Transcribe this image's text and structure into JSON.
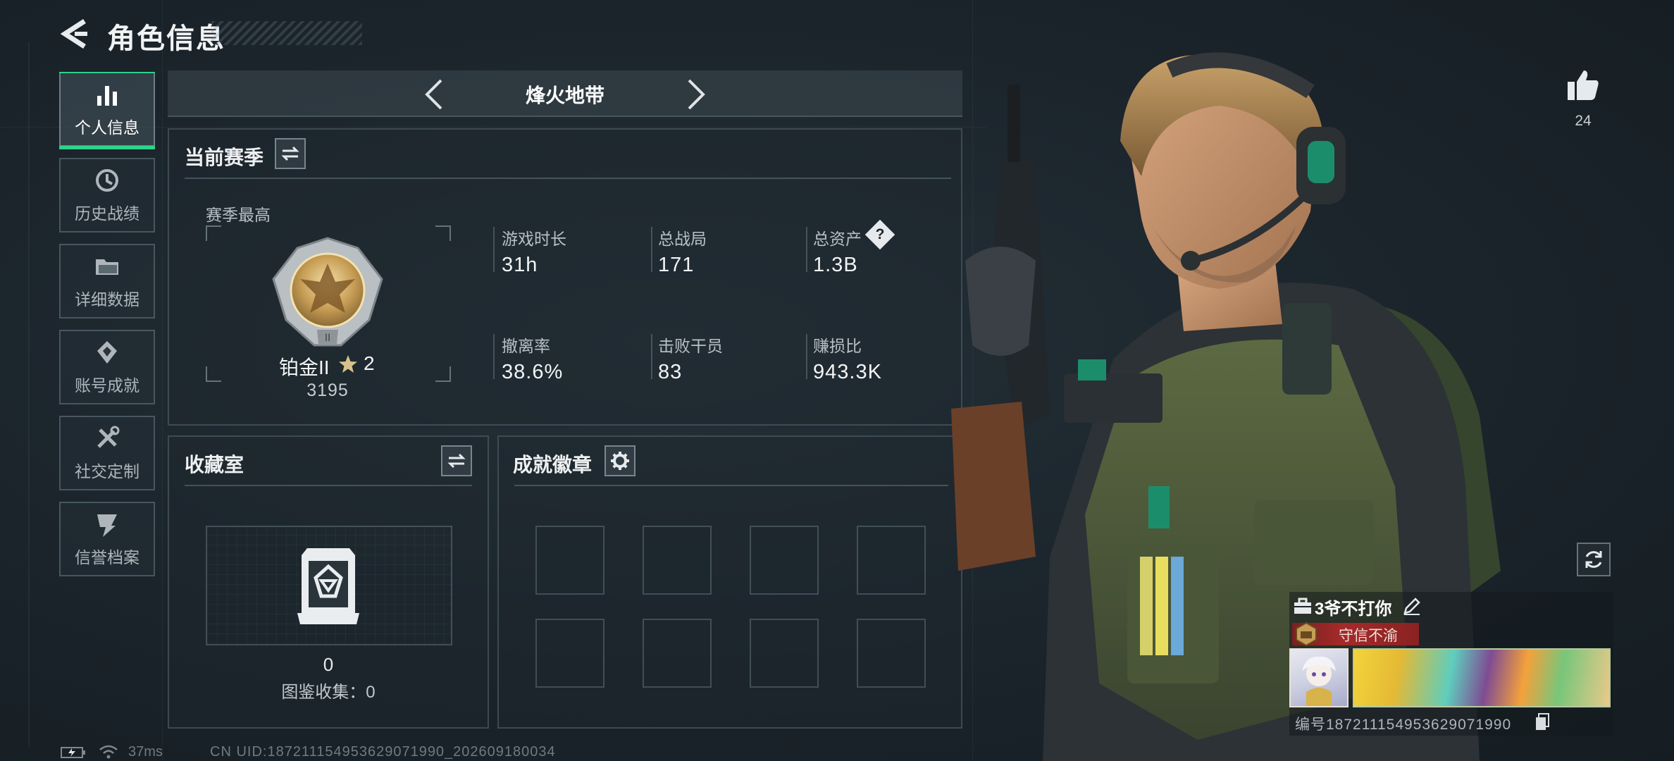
{
  "header": {
    "title": "角色信息"
  },
  "sidebar": {
    "items": [
      {
        "label": "个人信息",
        "icon": "bar-chart-icon",
        "active": true
      },
      {
        "label": "历史战绩",
        "icon": "history-clock-icon",
        "active": false
      },
      {
        "label": "详细数据",
        "icon": "folder-icon",
        "active": false
      },
      {
        "label": "账号成就",
        "icon": "achievement-icon",
        "active": false
      },
      {
        "label": "社交定制",
        "icon": "tools-icon",
        "active": false
      },
      {
        "label": "信誉档案",
        "icon": "credit-shield-icon",
        "active": false
      }
    ]
  },
  "mode": {
    "title": "烽火地带"
  },
  "season": {
    "heading": "当前赛季",
    "best_label": "赛季最高",
    "rank": "铂金II",
    "stars": "2",
    "score": "3195",
    "stats": [
      {
        "label": "游戏时长",
        "value": "31h"
      },
      {
        "label": "总战局",
        "value": "171"
      },
      {
        "label": "总资产",
        "value": "1.3B",
        "help": "?"
      },
      {
        "label": "撤离率",
        "value": "38.6%"
      },
      {
        "label": "击败干员",
        "value": "83"
      },
      {
        "label": "赚损比",
        "value": "943.3K"
      }
    ]
  },
  "collection": {
    "heading": "收藏室",
    "count": "0",
    "catalog_text": "图鉴收集：0"
  },
  "badges": {
    "heading": "成就徽章"
  },
  "player": {
    "likes": "24",
    "name": "3爷不打你",
    "honor_title": "守信不渝",
    "id_text": "编号1872111549536290719​90"
  },
  "status": {
    "ping": "37ms",
    "uid": "CN UID:1872111549536290719​90_202609180034"
  },
  "colors": {
    "accent_green": "#2fd38a",
    "honor_red": "#a52a2a"
  }
}
